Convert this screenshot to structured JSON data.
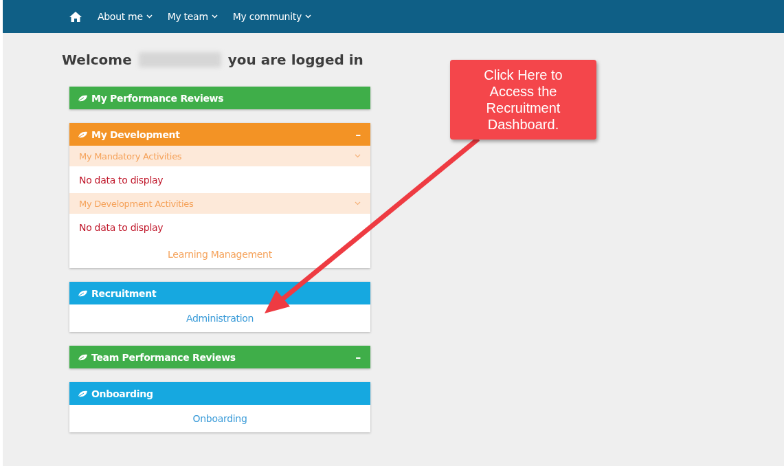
{
  "nav": {
    "items": [
      {
        "label": "About me"
      },
      {
        "label": "My team"
      },
      {
        "label": "My community"
      }
    ]
  },
  "welcome": {
    "before": "Welcome",
    "after": "you are logged in"
  },
  "panels": [
    {
      "title": "My Performance Reviews",
      "color": "#3fae49"
    },
    {
      "title": "My Development",
      "color": "#f39325",
      "toggle": "–",
      "body": [
        {
          "kind": "section",
          "text": "My Mandatory Activities",
          "expanded": false
        },
        {
          "kind": "empty",
          "text": "No data to display"
        },
        {
          "kind": "section",
          "text": "My Development Activities",
          "expanded": false
        },
        {
          "kind": "empty",
          "text": "No data to display"
        },
        {
          "kind": "link",
          "text": "Learning Management"
        }
      ]
    },
    {
      "title": "Recruitment",
      "color": "#16a8e0",
      "body": [
        {
          "kind": "link",
          "text": "Administration"
        }
      ]
    },
    {
      "title": "Team Performance Reviews",
      "color": "#3fae49",
      "toggle": "–"
    },
    {
      "title": "Onboarding",
      "color": "#16a8e0",
      "body": [
        {
          "kind": "link",
          "text": "Onboarding"
        }
      ]
    }
  ],
  "callout": {
    "text": "Click Here to Access the Recruitment Dashboard."
  }
}
